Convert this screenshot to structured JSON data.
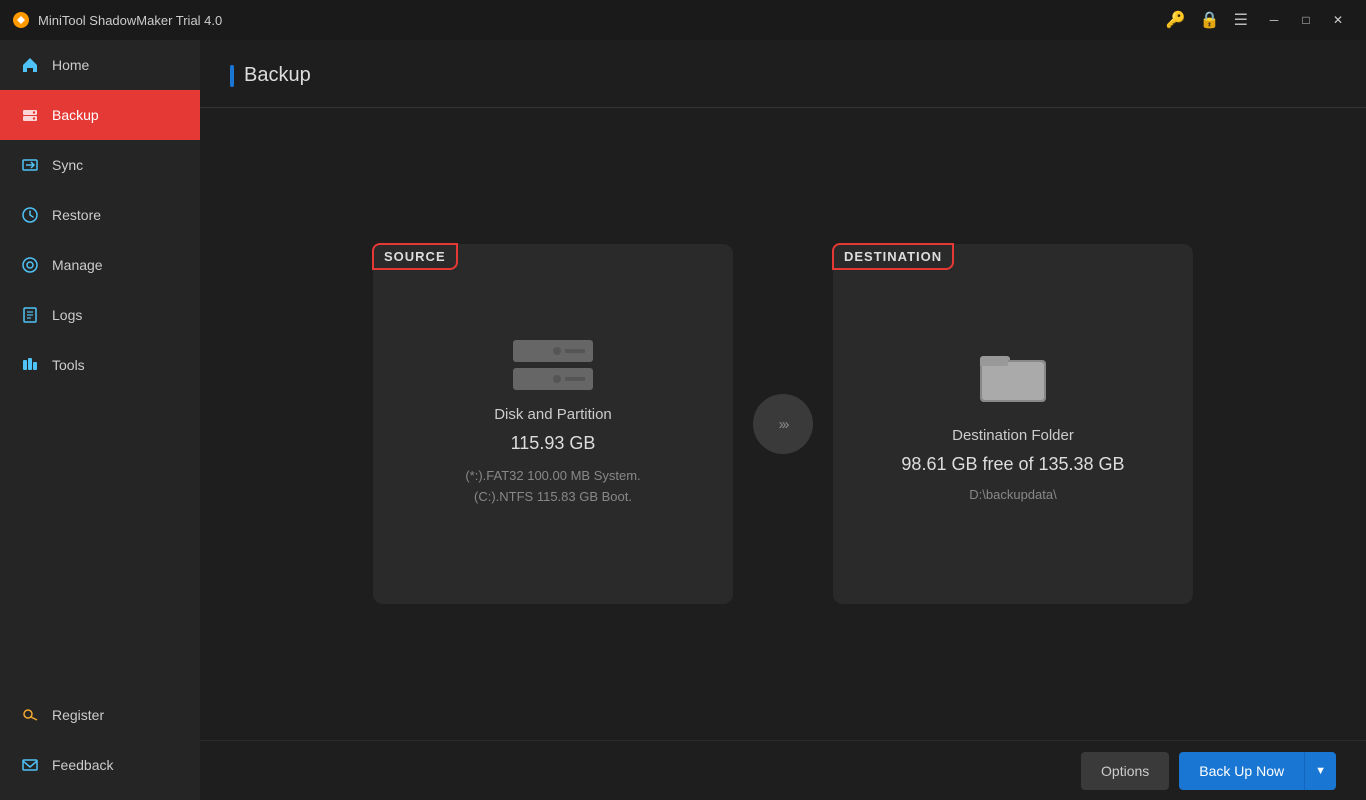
{
  "titleBar": {
    "appName": "MiniTool ShadowMaker Trial 4.0"
  },
  "sidebar": {
    "items": [
      {
        "id": "home",
        "label": "Home",
        "icon": "home-icon",
        "active": false
      },
      {
        "id": "backup",
        "label": "Backup",
        "icon": "backup-icon",
        "active": true
      },
      {
        "id": "sync",
        "label": "Sync",
        "icon": "sync-icon",
        "active": false
      },
      {
        "id": "restore",
        "label": "Restore",
        "icon": "restore-icon",
        "active": false
      },
      {
        "id": "manage",
        "label": "Manage",
        "icon": "manage-icon",
        "active": false
      },
      {
        "id": "logs",
        "label": "Logs",
        "icon": "logs-icon",
        "active": false
      },
      {
        "id": "tools",
        "label": "Tools",
        "icon": "tools-icon",
        "active": false
      }
    ],
    "bottomItems": [
      {
        "id": "register",
        "label": "Register",
        "icon": "key-icon"
      },
      {
        "id": "feedback",
        "label": "Feedback",
        "icon": "mail-icon"
      }
    ]
  },
  "content": {
    "pageTitle": "Backup",
    "sourceCard": {
      "label": "SOURCE",
      "iconType": "hdd",
      "mainText": "Disk and Partition",
      "size": "115.93 GB",
      "detail1": "(*:).FAT32 100.00 MB System.",
      "detail2": "(C:).NTFS 115.83 GB Boot."
    },
    "destinationCard": {
      "label": "DESTINATION",
      "iconType": "folder",
      "mainText": "Destination Folder",
      "freeSize": "98.61 GB free of 135.38 GB",
      "path": "D:\\backupdata\\"
    },
    "arrowSymbol": "»»»"
  },
  "bottomBar": {
    "optionsLabel": "Options",
    "backupNowLabel": "Back Up Now"
  }
}
